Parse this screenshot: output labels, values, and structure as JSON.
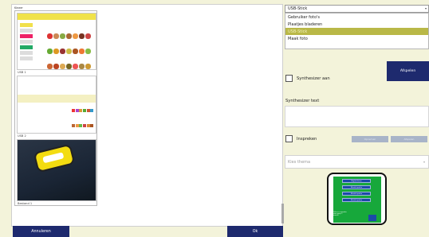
{
  "left_panel": {
    "title": "Kiezer",
    "thumbnails": [
      {
        "caption": "USB 1"
      },
      {
        "caption": "USB 2"
      },
      {
        "caption": "Bestand 1"
      }
    ]
  },
  "source_dropdown": {
    "selected": "USB-Stick",
    "options": [
      "Gebruiker foto's",
      "Plaatjes bladeren",
      "USB-Stick",
      "Maak foto"
    ],
    "selected_index": 2
  },
  "play_button": {
    "label": "Afspelen"
  },
  "synth_checkbox": {
    "label": "Synthesizer aan",
    "checked": false
  },
  "synth_text": {
    "label": "Synthesizer text",
    "value": ""
  },
  "record": {
    "checkbox_label": "Inspreken",
    "checked": false,
    "record_btn": "Opnemen",
    "play_btn": "Afspelen"
  },
  "theme_select": {
    "placeholder": "Kies thema"
  },
  "preview": {
    "buttons": [
      "Beginscherm",
      "Muziek spelen",
      "Muziek spelen",
      "Muziek spelen"
    ],
    "footer_lines": [
      "Cijfers en woorden",
      "voor groep 1",
      "www.nl"
    ]
  },
  "bottom": {
    "cancel_label": "Annuleren",
    "ok_label": "Ok"
  },
  "colors": {
    "background": "#f3f3da",
    "accent": "#1e2a6e",
    "selected_item": "#b9b847",
    "preview_green": "#17a83b"
  }
}
